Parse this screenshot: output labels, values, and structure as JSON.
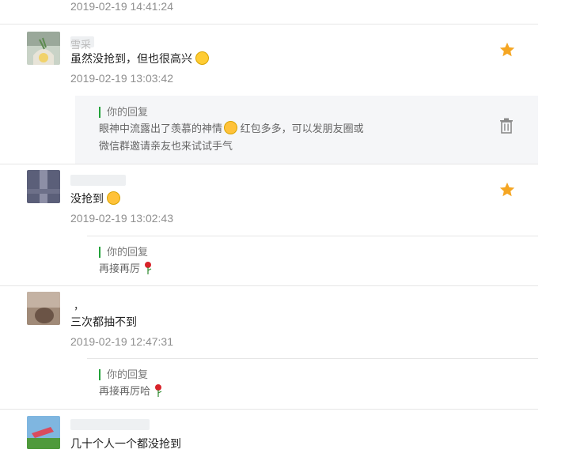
{
  "colors": {
    "accent_green": "#23a23a",
    "star_orange": "#f5a623",
    "timestamp_gray": "#8f8f8f"
  },
  "top_comment": {
    "timestamp": "2019-02-19 14:41:24"
  },
  "comments": [
    {
      "author": "雪采",
      "text": "虽然没抢到，但也很高兴",
      "emoji": "smiling-emoji",
      "timestamp": "2019-02-19 13:03:42",
      "starred": true,
      "reply": {
        "header": "你的回复",
        "line1": "眼神中流露出了羡慕的神情",
        "line1_emoji": "thinking-emoji",
        "line1_rest": " 红包多多，可以发朋友圈或",
        "line2": "微信群邀请亲友也来试试手气"
      }
    },
    {
      "author": "",
      "text": "没抢到",
      "emoji": "crying-emoji",
      "timestamp": "2019-02-19 13:02:43",
      "starred": true,
      "reply": {
        "header": "你的回复",
        "text": "再接再厉",
        "emoji": "rose-icon"
      }
    },
    {
      "author": "，",
      "text": "三次都抽不到",
      "timestamp": "2019-02-19 12:47:31",
      "starred": false,
      "reply": {
        "header": "你的回复",
        "text": "再接再厉哈",
        "emoji": "rose-icon"
      }
    },
    {
      "author": "",
      "text": "几十个人一个都没抢到",
      "starred": false
    }
  ]
}
